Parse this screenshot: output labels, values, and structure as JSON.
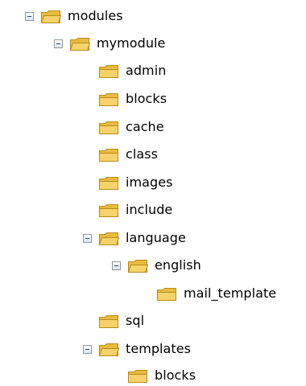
{
  "tree": [
    {
      "label": "modules",
      "depth": 0,
      "expanded": true,
      "icon": "folder-open-icon"
    },
    {
      "label": "mymodule",
      "depth": 1,
      "expanded": true,
      "icon": "folder-open-icon"
    },
    {
      "label": "admin",
      "depth": 2,
      "expanded": false,
      "icon": "folder-icon"
    },
    {
      "label": "blocks",
      "depth": 2,
      "expanded": false,
      "icon": "folder-icon"
    },
    {
      "label": "cache",
      "depth": 2,
      "expanded": false,
      "icon": "folder-icon"
    },
    {
      "label": "class",
      "depth": 2,
      "expanded": false,
      "icon": "folder-icon"
    },
    {
      "label": "images",
      "depth": 2,
      "expanded": false,
      "icon": "folder-icon"
    },
    {
      "label": "include",
      "depth": 2,
      "expanded": false,
      "icon": "folder-icon"
    },
    {
      "label": "language",
      "depth": 2,
      "expanded": true,
      "icon": "folder-open-icon"
    },
    {
      "label": "english",
      "depth": 3,
      "expanded": true,
      "icon": "folder-open-icon"
    },
    {
      "label": "mail_template",
      "depth": 4,
      "expanded": false,
      "icon": "folder-icon"
    },
    {
      "label": "sql",
      "depth": 2,
      "expanded": false,
      "icon": "folder-icon"
    },
    {
      "label": "templates",
      "depth": 2,
      "expanded": true,
      "icon": "folder-open-icon"
    },
    {
      "label": "blocks",
      "depth": 3,
      "expanded": false,
      "icon": "folder-icon"
    }
  ],
  "colors": {
    "toggle_border": "#8c9aa6",
    "toggle_minus": "#1d4c8c",
    "folder_fill": "#f6d36a",
    "folder_tab": "#e9bc40",
    "folder_outline": "#b88b1d"
  }
}
